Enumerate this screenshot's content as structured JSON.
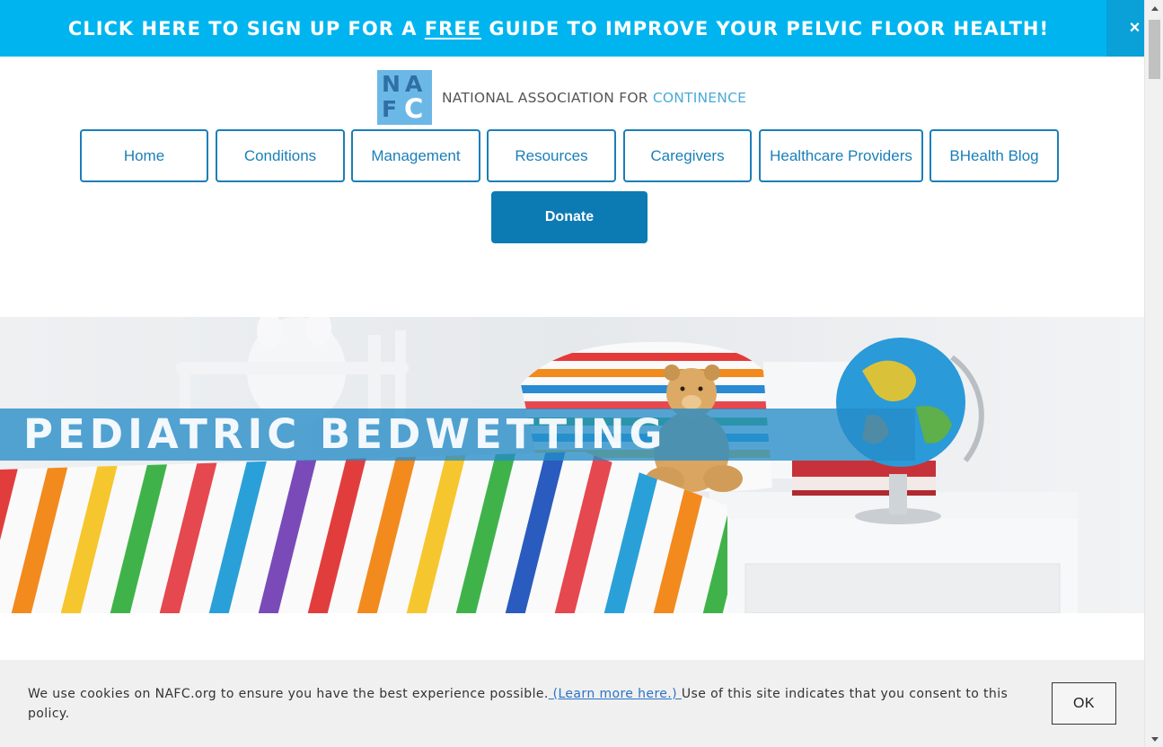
{
  "promo": {
    "text_before": "CLICK HERE TO SIGN UP FOR A ",
    "text_emphasis": "FREE",
    "text_after": " GUIDE TO IMPROVE YOUR PELVIC FLOOR HEALTH!",
    "close_label": "×"
  },
  "logo": {
    "letters": [
      "N",
      "A",
      "F",
      "C"
    ],
    "name_main": "NATIONAL ASSOCIATION FOR ",
    "name_accent": "CONTINENCE"
  },
  "nav": {
    "items": [
      {
        "label": "Home"
      },
      {
        "label": "Conditions"
      },
      {
        "label": "Management"
      },
      {
        "label": "Resources"
      },
      {
        "label": "Caregivers"
      },
      {
        "label": "Healthcare Providers"
      },
      {
        "label": "BHealth Blog"
      }
    ],
    "donate_label": "Donate"
  },
  "hero": {
    "title": "PEDIATRIC BEDWETTING"
  },
  "cookie": {
    "text_before": "We use cookies on NAFC.org to ensure you have the best experience possible.",
    "link_text": " (Learn more here.) ",
    "text_after": "Use of this site indicates that you consent to this policy.",
    "ok_label": "OK"
  },
  "colors": {
    "promo_bg": "#00b5ef",
    "brand_blue": "#1a7fb8",
    "donate_bg": "#0d7bb3",
    "hero_band": "#258cc8"
  },
  "icons": {
    "close": "close-icon",
    "scroll_up": "scroll-up-arrow",
    "scroll_down": "scroll-down-arrow"
  }
}
